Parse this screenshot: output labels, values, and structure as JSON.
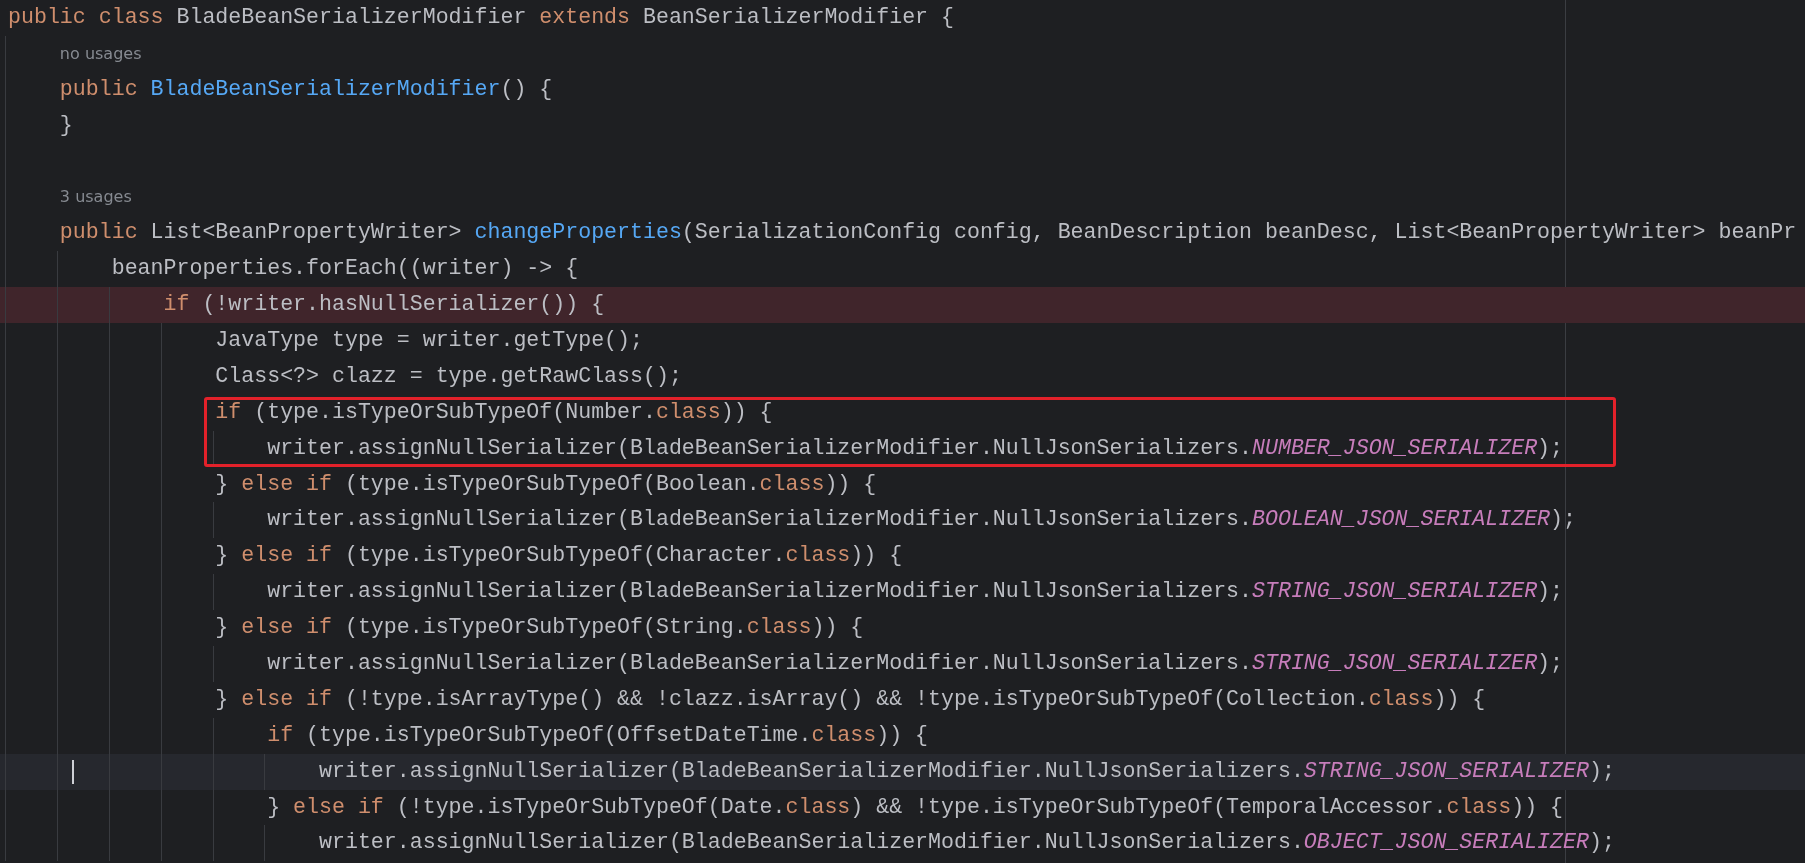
{
  "editor": {
    "lines": [
      {
        "kind": "code",
        "breakpoint": false,
        "current": false,
        "boxed": false,
        "tokens": [
          {
            "t": "public class ",
            "kind": "keyword"
          },
          {
            "t": "BladeBeanSerializerModifier ",
            "kind": "plain"
          },
          {
            "t": "extends ",
            "kind": "keyword"
          },
          {
            "t": "BeanSerializerModifier {",
            "kind": "plain"
          }
        ]
      },
      {
        "kind": "hint",
        "breakpoint": false,
        "current": false,
        "boxed": false,
        "tokens": [
          {
            "t": "    no usages",
            "kind": "hint"
          }
        ]
      },
      {
        "kind": "code",
        "breakpoint": false,
        "current": false,
        "boxed": false,
        "tokens": [
          {
            "t": "    public ",
            "kind": "keyword"
          },
          {
            "t": "BladeBeanSerializerModifier",
            "kind": "method"
          },
          {
            "t": "() {",
            "kind": "plain"
          }
        ]
      },
      {
        "kind": "code",
        "breakpoint": false,
        "current": false,
        "boxed": false,
        "tokens": [
          {
            "t": "    }",
            "kind": "plain"
          }
        ]
      },
      {
        "kind": "blank",
        "breakpoint": false,
        "current": false,
        "boxed": false
      },
      {
        "kind": "hint",
        "breakpoint": false,
        "current": false,
        "boxed": false,
        "tokens": [
          {
            "t": "    3 usages",
            "kind": "hint"
          }
        ]
      },
      {
        "kind": "code",
        "breakpoint": false,
        "current": false,
        "boxed": false,
        "tokens": [
          {
            "t": "    public ",
            "kind": "keyword"
          },
          {
            "t": "List<BeanPropertyWriter> ",
            "kind": "plain"
          },
          {
            "t": "changeProperties",
            "kind": "method"
          },
          {
            "t": "(SerializationConfig config, BeanDescription beanDesc, List<BeanPropertyWriter> beanPr",
            "kind": "plain"
          }
        ]
      },
      {
        "kind": "code",
        "breakpoint": false,
        "current": false,
        "boxed": false,
        "tokens": [
          {
            "t": "        beanProperties.forEach((writer) -> {",
            "kind": "plain"
          }
        ]
      },
      {
        "kind": "code",
        "breakpoint": true,
        "current": false,
        "boxed": false,
        "tokens": [
          {
            "t": "            if ",
            "kind": "keyword"
          },
          {
            "t": "(!writer.hasNullSerializer()) {",
            "kind": "plain"
          }
        ]
      },
      {
        "kind": "code",
        "breakpoint": false,
        "current": false,
        "boxed": false,
        "tokens": [
          {
            "t": "                JavaType type = writer.getType();",
            "kind": "plain"
          }
        ]
      },
      {
        "kind": "code",
        "breakpoint": false,
        "current": false,
        "boxed": false,
        "tokens": [
          {
            "t": "                Class<?> clazz = type.getRawClass();",
            "kind": "plain"
          }
        ]
      },
      {
        "kind": "code",
        "breakpoint": false,
        "current": false,
        "boxed": true,
        "tokens": [
          {
            "t": "                if ",
            "kind": "keyword"
          },
          {
            "t": "(type.isTypeOrSubTypeOf(Number.",
            "kind": "plain"
          },
          {
            "t": "class",
            "kind": "keyword"
          },
          {
            "t": ")) {",
            "kind": "plain"
          }
        ]
      },
      {
        "kind": "code",
        "breakpoint": false,
        "current": false,
        "boxed": true,
        "tokens": [
          {
            "t": "                    writer.assignNullSerializer(BladeBeanSerializerModifier.NullJsonSerializers.",
            "kind": "plain"
          },
          {
            "t": "NUMBER_JSON_SERIALIZER",
            "kind": "constant"
          },
          {
            "t": ");",
            "kind": "plain"
          }
        ]
      },
      {
        "kind": "code",
        "breakpoint": false,
        "current": false,
        "boxed": false,
        "tokens": [
          {
            "t": "                } ",
            "kind": "plain"
          },
          {
            "t": "else if ",
            "kind": "keyword"
          },
          {
            "t": "(type.isTypeOrSubTypeOf(Boolean.",
            "kind": "plain"
          },
          {
            "t": "class",
            "kind": "keyword"
          },
          {
            "t": ")) {",
            "kind": "plain"
          }
        ]
      },
      {
        "kind": "code",
        "breakpoint": false,
        "current": false,
        "boxed": false,
        "tokens": [
          {
            "t": "                    writer.assignNullSerializer(BladeBeanSerializerModifier.NullJsonSerializers.",
            "kind": "plain"
          },
          {
            "t": "BOOLEAN_JSON_SERIALIZER",
            "kind": "constant"
          },
          {
            "t": ");",
            "kind": "plain"
          }
        ]
      },
      {
        "kind": "code",
        "breakpoint": false,
        "current": false,
        "boxed": false,
        "tokens": [
          {
            "t": "                } ",
            "kind": "plain"
          },
          {
            "t": "else if ",
            "kind": "keyword"
          },
          {
            "t": "(type.isTypeOrSubTypeOf(Character.",
            "kind": "plain"
          },
          {
            "t": "class",
            "kind": "keyword"
          },
          {
            "t": ")) {",
            "kind": "plain"
          }
        ]
      },
      {
        "kind": "code",
        "breakpoint": false,
        "current": false,
        "boxed": false,
        "tokens": [
          {
            "t": "                    writer.assignNullSerializer(BladeBeanSerializerModifier.NullJsonSerializers.",
            "kind": "plain"
          },
          {
            "t": "STRING_JSON_SERIALIZER",
            "kind": "constant"
          },
          {
            "t": ");",
            "kind": "plain"
          }
        ]
      },
      {
        "kind": "code",
        "breakpoint": false,
        "current": false,
        "boxed": false,
        "tokens": [
          {
            "t": "                } ",
            "kind": "plain"
          },
          {
            "t": "else if ",
            "kind": "keyword"
          },
          {
            "t": "(type.isTypeOrSubTypeOf(String.",
            "kind": "plain"
          },
          {
            "t": "class",
            "kind": "keyword"
          },
          {
            "t": ")) {",
            "kind": "plain"
          }
        ]
      },
      {
        "kind": "code",
        "breakpoint": false,
        "current": false,
        "boxed": false,
        "tokens": [
          {
            "t": "                    writer.assignNullSerializer(BladeBeanSerializerModifier.NullJsonSerializers.",
            "kind": "plain"
          },
          {
            "t": "STRING_JSON_SERIALIZER",
            "kind": "constant"
          },
          {
            "t": ");",
            "kind": "plain"
          }
        ]
      },
      {
        "kind": "code",
        "breakpoint": false,
        "current": false,
        "boxed": false,
        "tokens": [
          {
            "t": "                } ",
            "kind": "plain"
          },
          {
            "t": "else if ",
            "kind": "keyword"
          },
          {
            "t": "(!type.isArrayType() && !clazz.isArray() && !type.isTypeOrSubTypeOf(Collection.",
            "kind": "plain"
          },
          {
            "t": "class",
            "kind": "keyword"
          },
          {
            "t": ")) {",
            "kind": "plain"
          }
        ]
      },
      {
        "kind": "code",
        "breakpoint": false,
        "current": false,
        "boxed": false,
        "tokens": [
          {
            "t": "                    if ",
            "kind": "keyword"
          },
          {
            "t": "(type.isTypeOrSubTypeOf(OffsetDateTime.",
            "kind": "plain"
          },
          {
            "t": "class",
            "kind": "keyword"
          },
          {
            "t": ")) {",
            "kind": "plain"
          }
        ]
      },
      {
        "kind": "code",
        "breakpoint": false,
        "current": true,
        "boxed": false,
        "tokens": [
          {
            "t": "                        writer.assignNullSerializer(BladeBeanSerializerModifier.NullJsonSerializers.",
            "kind": "plain"
          },
          {
            "t": "STRING_JSON_SERIALIZER",
            "kind": "constant"
          },
          {
            "t": ");",
            "kind": "plain"
          }
        ]
      },
      {
        "kind": "code",
        "breakpoint": false,
        "current": false,
        "boxed": false,
        "tokens": [
          {
            "t": "                    } ",
            "kind": "plain"
          },
          {
            "t": "else if ",
            "kind": "keyword"
          },
          {
            "t": "(!type.isTypeOrSubTypeOf(Date.",
            "kind": "plain"
          },
          {
            "t": "class",
            "kind": "keyword"
          },
          {
            "t": ") && !type.isTypeOrSubTypeOf(TemporalAccessor.",
            "kind": "plain"
          },
          {
            "t": "class",
            "kind": "keyword"
          },
          {
            "t": ")) {",
            "kind": "plain"
          }
        ]
      },
      {
        "kind": "code",
        "breakpoint": false,
        "current": false,
        "boxed": false,
        "tokens": [
          {
            "t": "                        writer.assignNullSerializer(BladeBeanSerializerModifier.NullJsonSerializers.",
            "kind": "plain"
          },
          {
            "t": "OBJECT_JSON_SERIALIZER",
            "kind": "constant"
          },
          {
            "t": ");",
            "kind": "plain"
          }
        ]
      }
    ]
  }
}
